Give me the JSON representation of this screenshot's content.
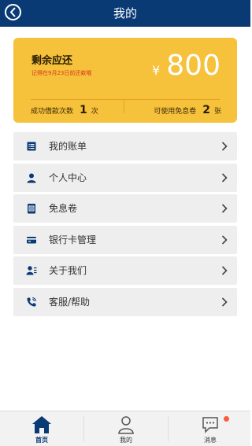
{
  "header": {
    "title": "我的",
    "back_icon": "back-icon"
  },
  "card": {
    "title": "剩余应还",
    "note": "记得在9月23日前还款哦",
    "currency": "¥",
    "amount": "800",
    "stats": {
      "success_label": "成功借款次数",
      "success_value": "1",
      "success_unit": "次",
      "voucher_label": "可使用免息卷",
      "voucher_value": "2",
      "voucher_unit": "张"
    },
    "color": "#f6c13b"
  },
  "menu": {
    "items": [
      {
        "label": "我的账单",
        "icon": "bill-icon"
      },
      {
        "label": "个人中心",
        "icon": "person-icon"
      },
      {
        "label": "免息卷",
        "icon": "voucher-icon"
      },
      {
        "label": "银行卡管理",
        "icon": "bank-card-icon"
      },
      {
        "label": "关于我们",
        "icon": "about-icon"
      },
      {
        "label": "客服/帮助",
        "icon": "phone-icon"
      }
    ]
  },
  "tabbar": {
    "tabs": [
      {
        "label": "首页",
        "icon": "home-icon",
        "active": true
      },
      {
        "label": "我的",
        "icon": "user-icon",
        "active": false
      },
      {
        "label": "消息",
        "icon": "message-icon",
        "active": false
      }
    ]
  },
  "colors": {
    "brand": "#0a3a74",
    "accent": "#f6c13b",
    "badge": "#ff5a3c"
  }
}
